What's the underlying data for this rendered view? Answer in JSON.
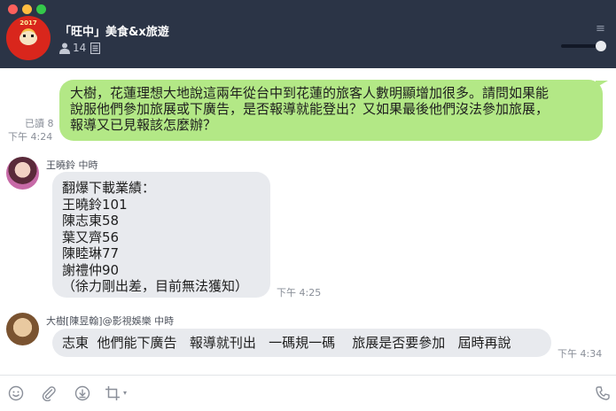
{
  "header": {
    "group_name": "「旺中」美食&x旅遊",
    "member_count": "14",
    "avatar_text": "2017",
    "menu_glyph": "≡"
  },
  "messages": {
    "outgoing": {
      "lines": [
        "大樹，花蓮理想大地說這兩年從台中到花蓮的旅客人數明顯增加很多。請問如果能",
        "說服他們參加旅展或下廣告，是否報導就能登出？又如果最後他們沒法參加旅展，",
        "報導又已見報該怎麼辦？"
      ],
      "read_status": "已讀 8",
      "time": "下午 4:24"
    },
    "incoming1": {
      "sender": "王曉鈴 中時",
      "lines": [
        "翻爆下載業績：",
        "王曉鈴101",
        "陳志東58",
        "葉又齊56",
        "陳睦琳77",
        "謝禮仲90",
        "（徐力剛出差，目前無法獲知）"
      ],
      "time": "下午 4:25"
    },
    "incoming2": {
      "sender": "大樹[陳昱翰]@影視娛樂 中時",
      "text": "志東  他們能下廣告   報導就刊出   一碼規一碼    旅展是否要參加   屆時再說",
      "time": "下午 4:34"
    }
  },
  "toolbar": {
    "crop_caret": "▾"
  },
  "colors": {
    "header_bg": "#2b3446",
    "outgoing_bubble": "#b3e886",
    "incoming_bubble": "#e8eaee",
    "meta_text": "#8a8f99"
  },
  "icons": [
    "member-icon",
    "notes-icon",
    "menu-icon",
    "emoji-icon",
    "attach-icon",
    "save-icon",
    "crop-icon",
    "call-icon"
  ]
}
